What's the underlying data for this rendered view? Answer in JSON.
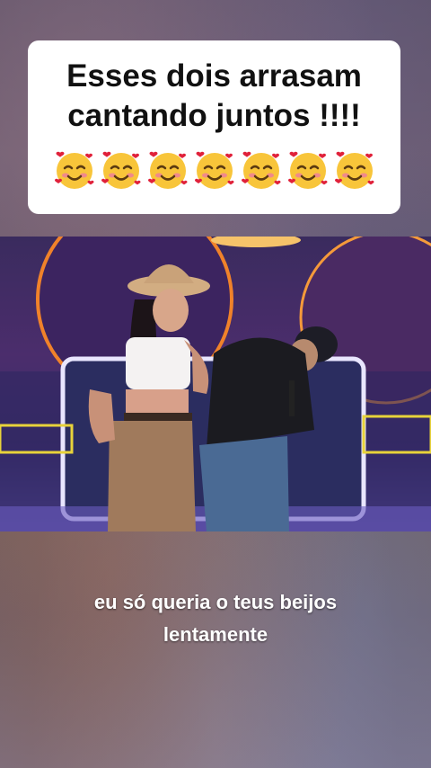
{
  "caption": {
    "line1": "Esses dois arrasam",
    "line2": "cantando juntos !!!!",
    "emoji_name": "smiling-face-with-hearts-icon",
    "emoji_count": 7
  },
  "subtitles": {
    "line1": "eu só queria o teus beijos",
    "line2": "lentamente"
  }
}
